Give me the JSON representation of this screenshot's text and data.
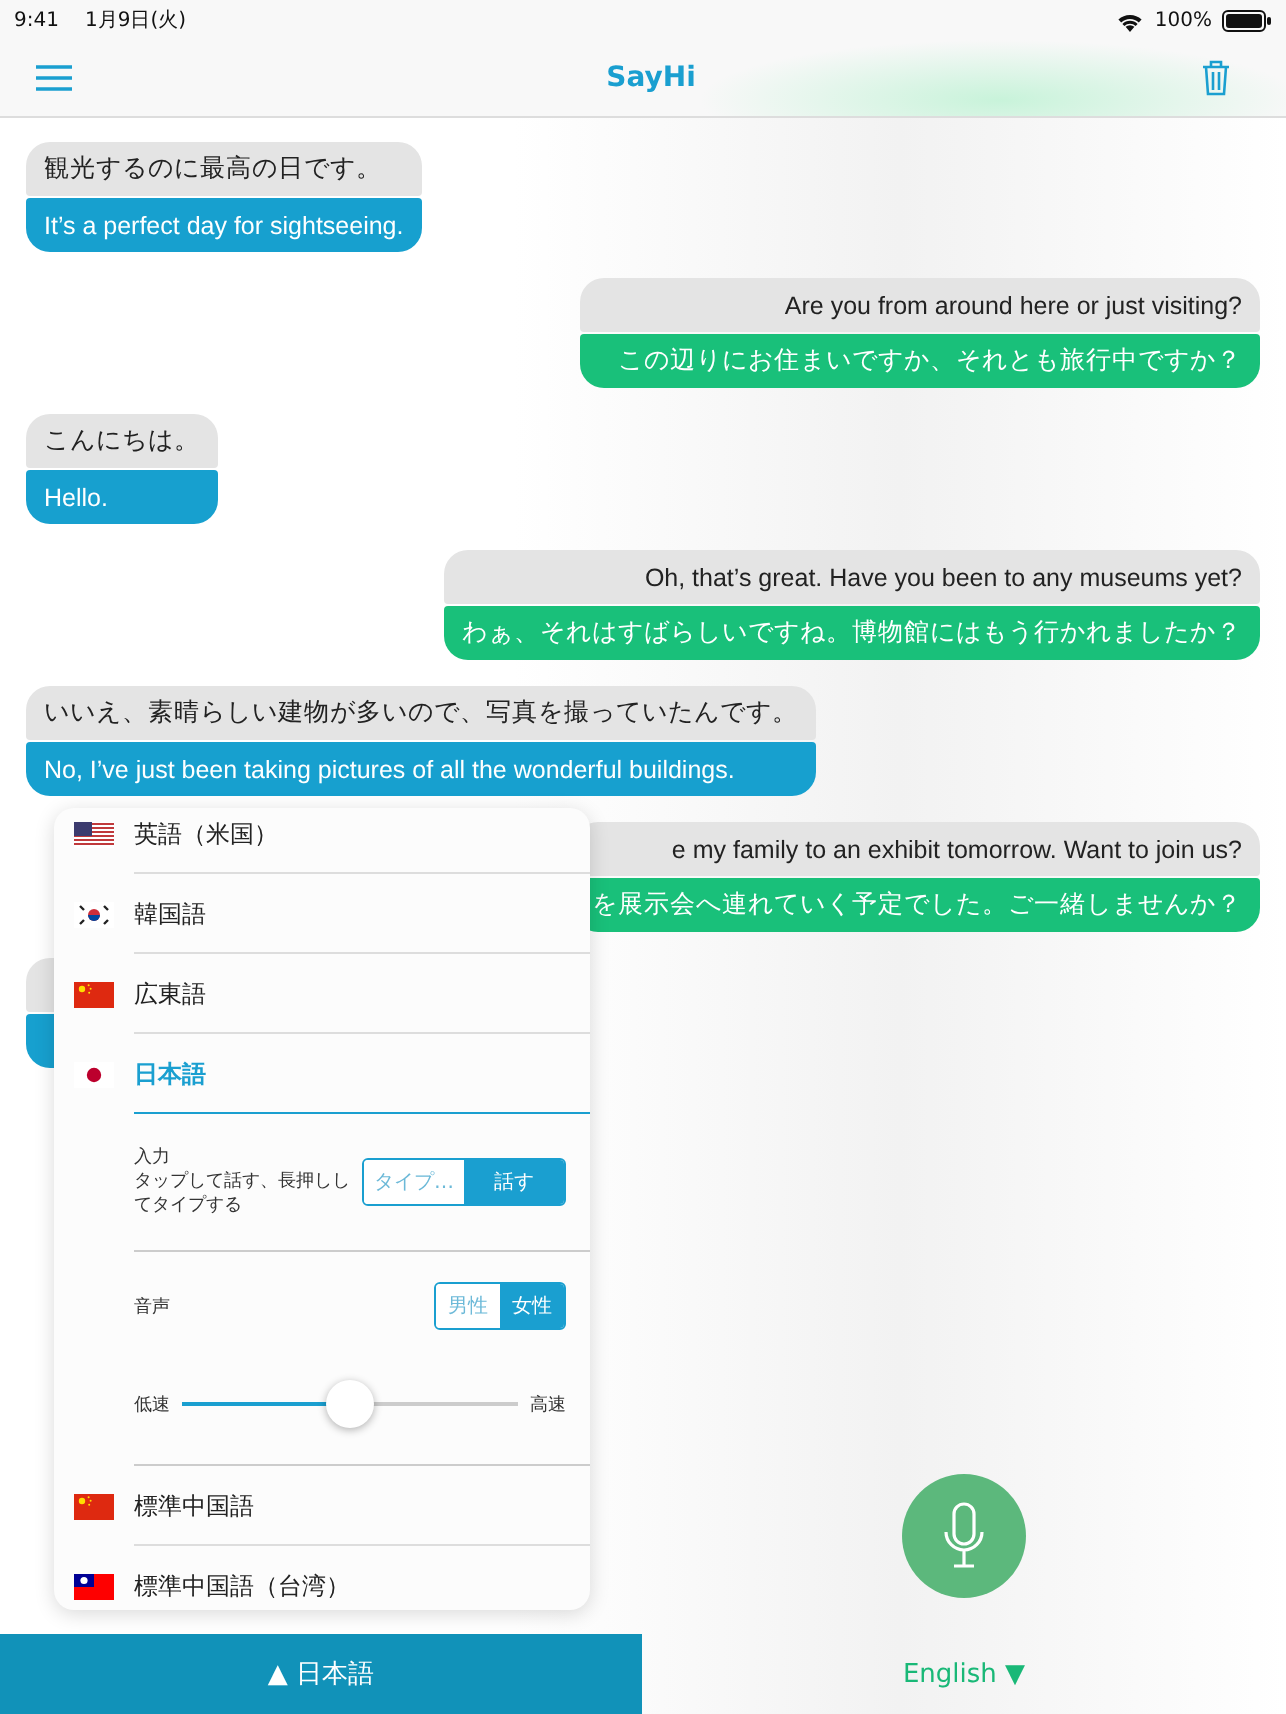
{
  "status_bar": {
    "time": "9:41",
    "date": "1月9日(火)",
    "battery": "100%"
  },
  "nav": {
    "title": "SayHi"
  },
  "messages": [
    {
      "kind": "received",
      "original": "観光するのに最高の日です。",
      "translation": "It’s a perfect day for sightseeing."
    },
    {
      "kind": "sent",
      "original": "Are you from around here or just visiting?",
      "translation": "この辺りにお住まいですか、それとも旅行中ですか？"
    },
    {
      "kind": "received",
      "original": "こんにちは。",
      "translation": "Hello."
    },
    {
      "kind": "sent",
      "original": "Oh, that’s great. Have you been to any museums yet?",
      "translation": "わぁ、それはすばらしいですね。博物館にはもう行かれましたか？"
    },
    {
      "kind": "received",
      "original": "いいえ、素晴らしい建物が多いので、写真を撮っていたんです。",
      "translation": "No, I’ve just been taking pictures of all the wonderful buildings."
    },
    {
      "kind": "sent",
      "original": "e my family to an exhibit tomorrow. Want to join us?",
      "translation": "を展示会へ連れていく予定でした。ご一緒しませんか？"
    }
  ],
  "languages": [
    {
      "kind": "us",
      "label": "英語（米国）",
      "selected": false
    },
    {
      "kind": "kr",
      "label": "韓国語",
      "selected": false
    },
    {
      "kind": "cn",
      "label": "広東語",
      "selected": false
    },
    {
      "kind": "jp",
      "label": "日本語",
      "selected": true
    },
    {
      "kind": "cn",
      "label": "標準中国語",
      "selected": false
    },
    {
      "kind": "tw",
      "label": "標準中国語（台湾）",
      "selected": false
    }
  ],
  "settings": {
    "input_label": "入力",
    "input_hint": "タップして話す、長押ししてタイプする",
    "input_options": [
      {
        "label": "タイプ…",
        "selected": false
      },
      {
        "label": "話す",
        "selected": true
      }
    ],
    "voice_label": "音声",
    "voice_options": [
      {
        "label": "男性",
        "selected": false
      },
      {
        "label": "女性",
        "selected": true
      }
    ],
    "slow_label": "低速",
    "fast_label": "高速",
    "speed": {
      "level": 0.5
    }
  },
  "bottom_bar": {
    "source": "▲ 日本語",
    "target": "English ▼"
  }
}
